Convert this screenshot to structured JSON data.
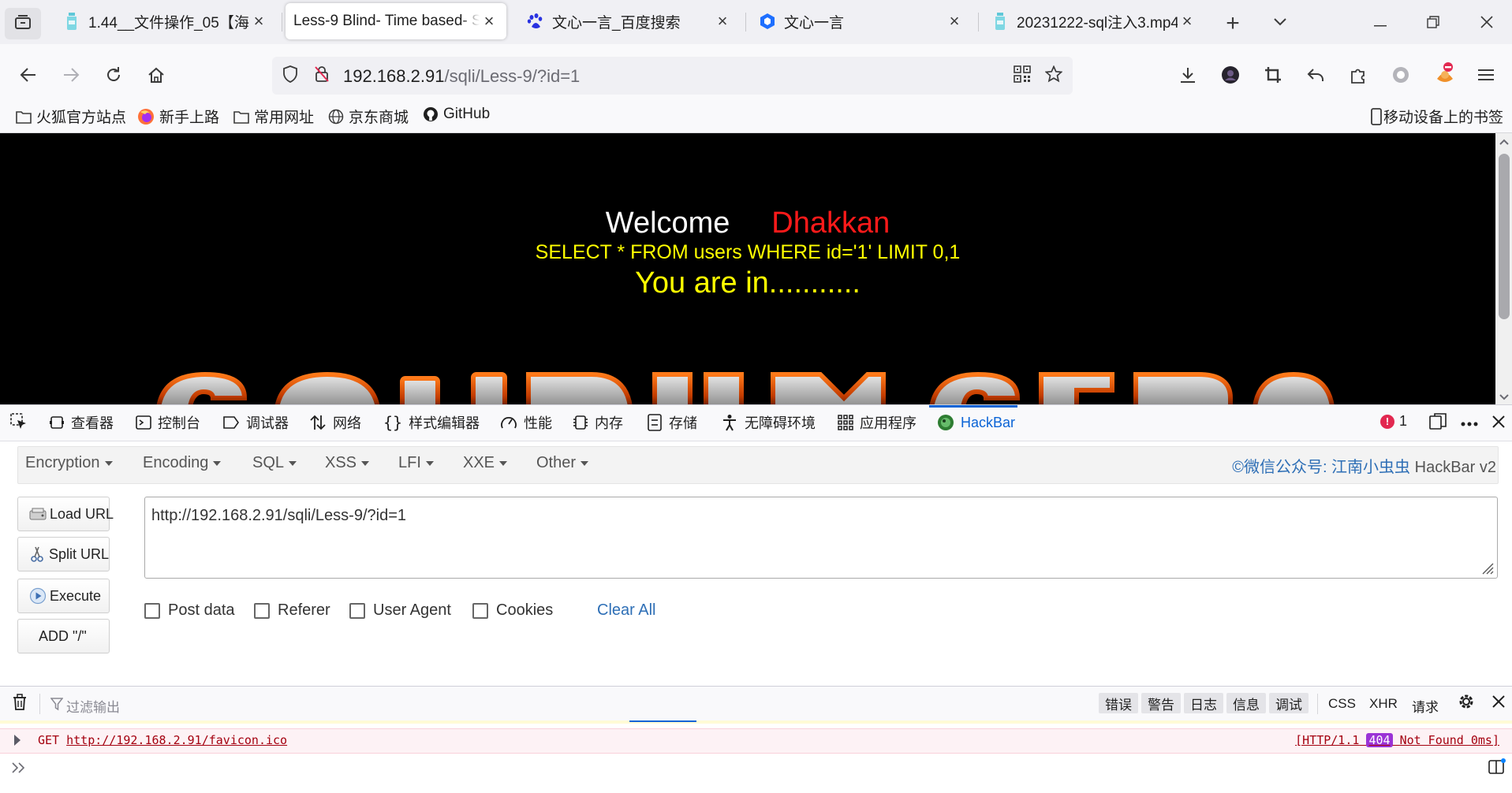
{
  "tabs": [
    {
      "title": "1.44__文件操作_05【海量",
      "icon": "bottle-icon",
      "active": false
    },
    {
      "title": "Less-9 Blind- Time based- S",
      "icon": "",
      "active": true
    },
    {
      "title": "文心一言_百度搜索",
      "icon": "baidu-paw-icon",
      "active": false
    },
    {
      "title": "文心一言",
      "icon": "cube-icon",
      "active": false
    },
    {
      "title": "20231222-sql注入3.mp4",
      "icon": "bottle-icon",
      "active": false
    }
  ],
  "address": {
    "host": "192.168.2.91",
    "path": "/sqli/Less-9/?id=1"
  },
  "bookmarks": [
    {
      "label": "火狐官方站点",
      "icon": "folder-icon"
    },
    {
      "label": "新手上路",
      "icon": "firefox-icon"
    },
    {
      "label": "常用网址",
      "icon": "folder-icon"
    },
    {
      "label": "京东商城",
      "icon": "globe-icon"
    },
    {
      "label": "GitHub",
      "icon": "github-icon"
    },
    {
      "label": "移动设备上的书签",
      "icon": "mobile-icon"
    }
  ],
  "page": {
    "welcome": "Welcome",
    "name": "Dhakkan",
    "query": "SELECT * FROM users WHERE id='1' LIMIT 0,1",
    "result": "You are in..........."
  },
  "devtools": {
    "tabs": [
      {
        "label": "查看器",
        "icon": "inspector-icon"
      },
      {
        "label": "控制台",
        "icon": "console-icon"
      },
      {
        "label": "调试器",
        "icon": "debugger-icon"
      },
      {
        "label": "网络",
        "icon": "network-icon"
      },
      {
        "label": "样式编辑器",
        "icon": "braces-icon"
      },
      {
        "label": "性能",
        "icon": "gauge-icon"
      },
      {
        "label": "内存",
        "icon": "memory-icon"
      },
      {
        "label": "存储",
        "icon": "storage-icon"
      },
      {
        "label": "无障碍环境",
        "icon": "accessibility-icon"
      },
      {
        "label": "应用程序",
        "icon": "grid-icon"
      },
      {
        "label": "HackBar",
        "icon": "hackbar-icon"
      }
    ],
    "error_count": "1"
  },
  "hackbar": {
    "menus": [
      "Encryption",
      "Encoding",
      "SQL",
      "XSS",
      "LFI",
      "XXE",
      "Other"
    ],
    "credit": "©微信公众号: 江南小虫虫",
    "version": "HackBar v2",
    "buttons": {
      "load": "Load URL",
      "split": "Split URL",
      "execute": "Execute",
      "add": "ADD \"/\""
    },
    "url_value": "http://192.168.2.91/sqli/Less-9/?id=1",
    "checks": [
      "Post data",
      "Referer",
      "User Agent",
      "Cookies"
    ],
    "clear": "Clear All"
  },
  "console": {
    "filter_placeholder": "过滤输出",
    "levels": [
      "错误",
      "警告",
      "日志",
      "信息",
      "调试"
    ],
    "extra": [
      "CSS",
      "XHR",
      "请求"
    ],
    "message": {
      "method": "GET",
      "url": "http://192.168.2.91/favicon.ico",
      "protocol": "[HTTP/1.1",
      "code": "404",
      "status": "Not Found 0ms]"
    }
  },
  "colors": {
    "accent": "#0b64d6",
    "welcome_name": "#ff1a1a",
    "query": "#ffff00",
    "error": "#a4000f"
  }
}
